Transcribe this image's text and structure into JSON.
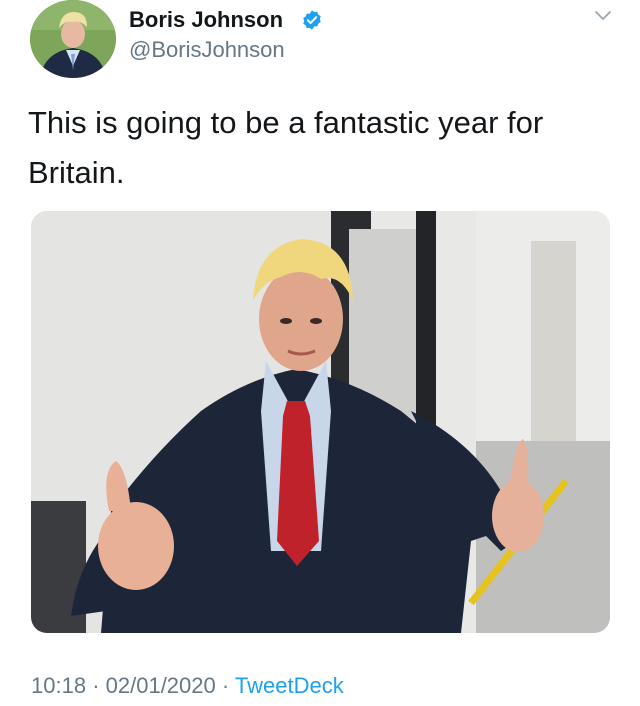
{
  "tweet": {
    "author": {
      "display_name": "Boris Johnson",
      "handle": "@BorisJohnson",
      "verified": true,
      "avatar_icon": "profile-photo"
    },
    "menu_icon": "chevron-down-icon",
    "text": "This is going to be a fantastic year for Britain.",
    "media": {
      "type": "photo"
    },
    "time": "10:18",
    "separator": "·",
    "date": "02/01/2020",
    "source": "TweetDeck"
  },
  "colors": {
    "text_primary": "#14171a",
    "text_secondary": "#657786",
    "accent": "#1da1f2"
  }
}
